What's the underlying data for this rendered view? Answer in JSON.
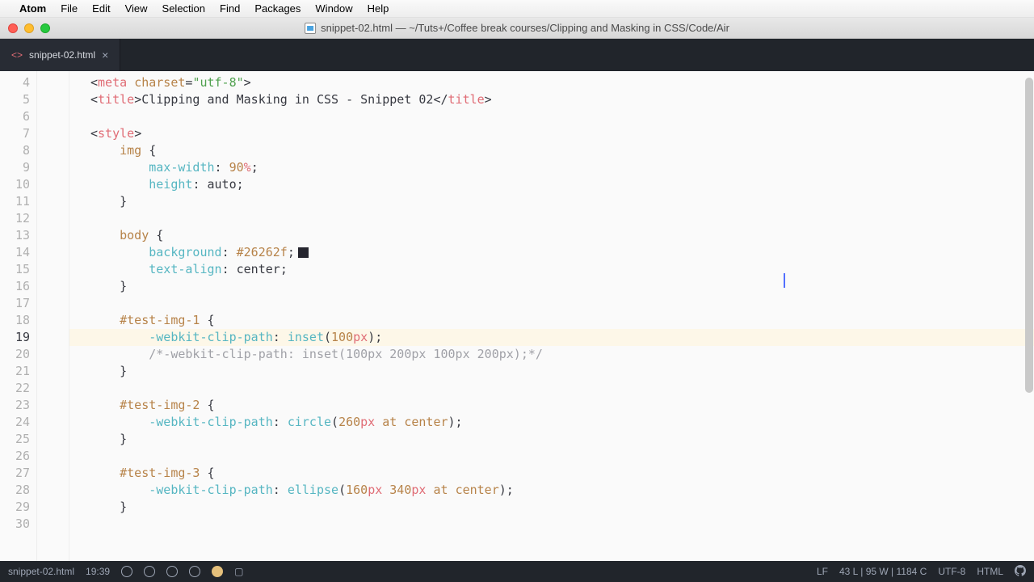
{
  "menubar": {
    "apple": "",
    "app": "Atom",
    "items": [
      "File",
      "Edit",
      "View",
      "Selection",
      "Find",
      "Packages",
      "Window",
      "Help"
    ]
  },
  "window": {
    "title": "snippet-02.html — ~/Tuts+/Coffee break courses/Clipping and Masking in CSS/Code/Air"
  },
  "tab": {
    "filename": "snippet-02.html",
    "close": "×",
    "langprefix": "<>"
  },
  "gutter": {
    "start": 4,
    "end": 30,
    "current": 19
  },
  "code": {
    "l4": {
      "tag": "meta",
      "attr": "charset",
      "val": "\"utf-8\""
    },
    "l5": {
      "tag": "title",
      "text": "Clipping and Masking in CSS - Snippet 02"
    },
    "l7": {
      "tag": "style"
    },
    "l8": {
      "sel": "img"
    },
    "l9": {
      "prop": "max-width",
      "num": "90",
      "unit": "%"
    },
    "l10": {
      "prop": "height",
      "val": "auto"
    },
    "l13": {
      "sel": "body"
    },
    "l14": {
      "prop": "background",
      "val": "#26262f"
    },
    "l15": {
      "prop": "text-align",
      "val": "center"
    },
    "l18": {
      "sel": "#test-img-1"
    },
    "l19": {
      "prop": "-webkit-clip-path",
      "fn": "inset",
      "num": "100",
      "unit": "px"
    },
    "l20": {
      "comment": "/*-webkit-clip-path: inset(100px 200px 100px 200px);*/"
    },
    "l23": {
      "sel": "#test-img-2"
    },
    "l24": {
      "prop": "-webkit-clip-path",
      "fn": "circle",
      "num": "260",
      "unit": "px",
      "kw1": "at",
      "kw2": "center"
    },
    "l27": {
      "sel": "#test-img-3"
    },
    "l28": {
      "prop": "-webkit-clip-path",
      "fn": "ellipse",
      "num1": "160",
      "num2": "340",
      "unit": "px",
      "kw1": "at",
      "kw2": "center"
    }
  },
  "statusbar": {
    "file": "snippet-02.html",
    "cursor": "19:39",
    "lines": "43 L",
    "words": "95 W",
    "chars": "1184 C",
    "lf": "LF",
    "encoding": "UTF-8",
    "lang": "HTML"
  }
}
